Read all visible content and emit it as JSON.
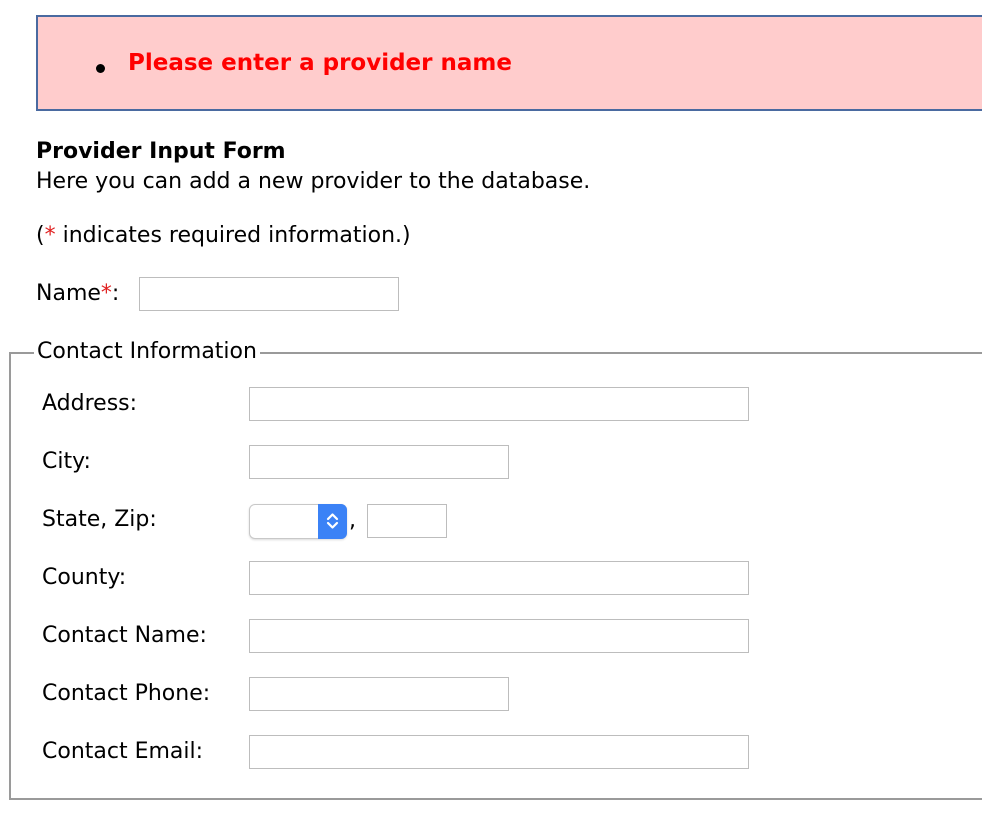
{
  "error": {
    "messages": [
      "Please enter a provider name"
    ]
  },
  "form": {
    "title": "Provider Input Form",
    "description": "Here you can add a new provider to the database.",
    "required_note_open": "(",
    "required_marker": "*",
    "required_note_text": " indicates required information.)",
    "name_label": "Name",
    "name_suffix": ":",
    "name_value": ""
  },
  "contact": {
    "legend": "Contact Information",
    "address_label": "Address:",
    "address_value": "",
    "city_label": "City:",
    "city_value": "",
    "state_zip_label": "State, Zip:",
    "state_value": "",
    "zip_separator": ",",
    "zip_value": "",
    "county_label": "County:",
    "county_value": "",
    "contact_name_label": "Contact Name:",
    "contact_name_value": "",
    "contact_phone_label": "Contact Phone:",
    "contact_phone_value": "",
    "contact_email_label": "Contact Email:",
    "contact_email_value": ""
  },
  "colors": {
    "error_background": "#ffcccc",
    "error_text": "#ff0000",
    "required_marker": "#e02020",
    "select_accent": "#3b82f6"
  }
}
